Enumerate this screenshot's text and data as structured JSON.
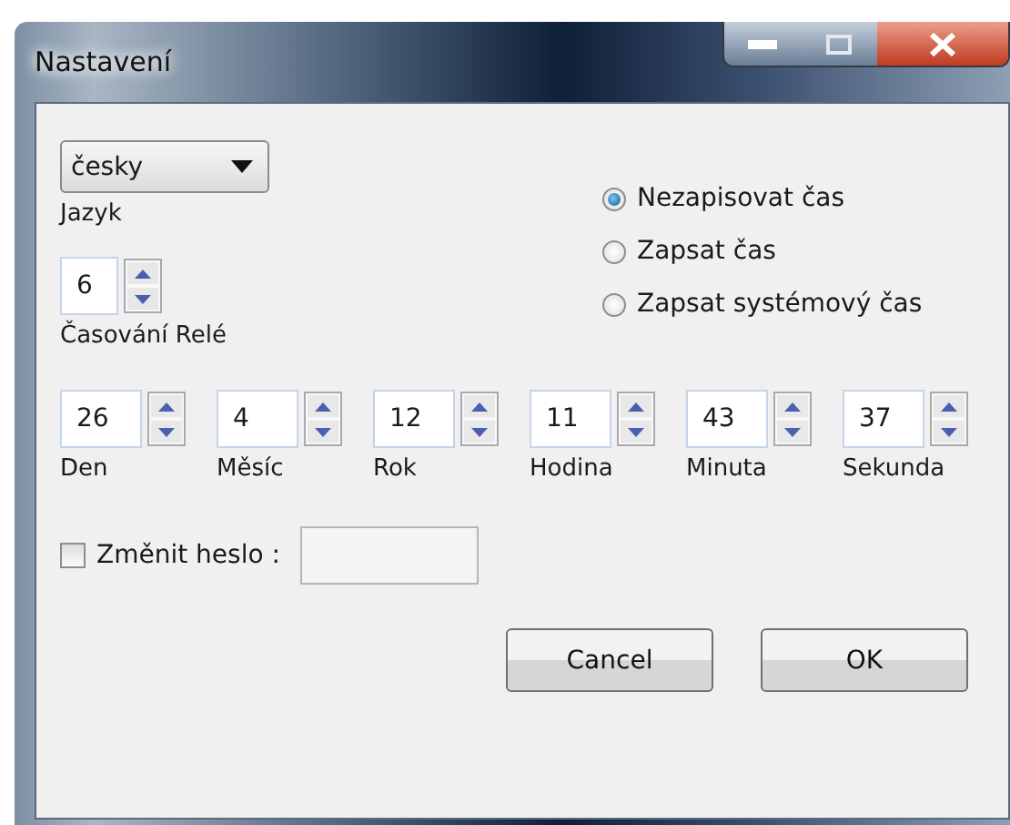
{
  "window": {
    "title": "Nastavení"
  },
  "language": {
    "value": "česky",
    "label": "Jazyk"
  },
  "relay": {
    "value": "6",
    "label": "Časování Relé"
  },
  "time_mode": [
    {
      "label": "Nezapisovat čas",
      "selected": true
    },
    {
      "label": "Zapsat čas",
      "selected": false
    },
    {
      "label": "Zapsat systémový čas",
      "selected": false
    }
  ],
  "date_time": [
    {
      "value": "26",
      "label": "Den"
    },
    {
      "value": "4",
      "label": "Měsíc"
    },
    {
      "value": "12",
      "label": "Rok"
    },
    {
      "value": "11",
      "label": "Hodina"
    },
    {
      "value": "43",
      "label": "Minuta"
    },
    {
      "value": "37",
      "label": "Sekunda"
    }
  ],
  "change_password": {
    "label": "Změnit heslo :",
    "checked": false
  },
  "buttons": [
    "Cancel",
    "OK"
  ]
}
